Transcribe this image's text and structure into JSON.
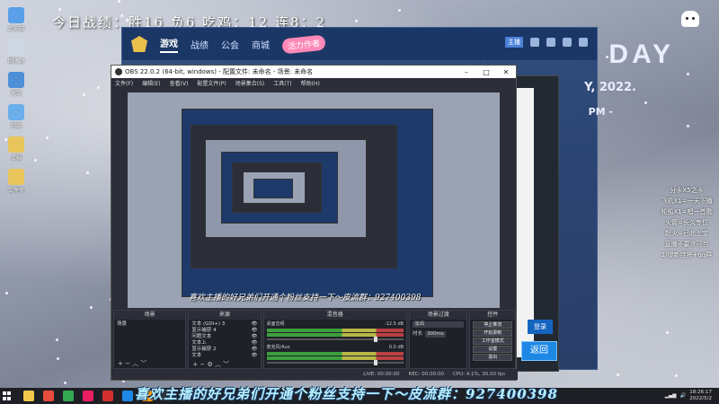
{
  "overlay": {
    "stats_line": "今日战绩：胜16  负6    吃鸡：12   连8：2"
  },
  "desktop": {
    "icons": [
      {
        "label": "此电脑",
        "color": "#5aa0e8"
      },
      {
        "label": "回收站",
        "color": "#cfd8e6"
      },
      {
        "label": "宽带",
        "color": "#4d90d8"
      },
      {
        "label": "网络",
        "color": "#6aaeea"
      },
      {
        "label": "文档",
        "color": "#e8c45a"
      },
      {
        "label": "文件夹",
        "color": "#e8c45a"
      }
    ]
  },
  "launcher": {
    "nav": [
      "游戏",
      "战绩",
      "公会",
      "商城"
    ],
    "badge": "活力作者",
    "user_tag": "主播",
    "day_text": "DAY",
    "year_text": "Y, 2022.",
    "pm_text": "PM -",
    "return_label": "返回",
    "blue_button": "登录"
  },
  "side_note": "分卡X5之卡\n飞机X1=一天下播\n轮船X1=唱一首歌\n火箭=长久专位\n超火=已此上宝\n直播不要许可当\n1/提新挂将+qq群",
  "obs": {
    "title": "OBS 22.0.2 (64-bit, windows) - 配置文件: 未命名 - 场景: 未命名",
    "menu": [
      "文件(F)",
      "编辑(E)",
      "查看(V)",
      "配置文件(P)",
      "场景集合(S)",
      "工具(T)",
      "帮助(H)"
    ],
    "docks": {
      "scenes": {
        "title": "场景",
        "items": [
          "场景"
        ]
      },
      "sources": {
        "title": "来源",
        "items": [
          "文本 (GDI+) 3",
          "显示捕获 4",
          "问题文本",
          "文本上",
          "显示捕获 2",
          "文本"
        ]
      },
      "mixer": {
        "title": "混音器",
        "channels": [
          {
            "name": "桌面音频",
            "db": "-12.5 dB"
          },
          {
            "name": "麦克风/Aux",
            "db": "0.0 dB"
          }
        ]
      },
      "transitions": {
        "title": "场景过渡",
        "type": "淡出",
        "duration_label": "时长",
        "duration": "300ms"
      },
      "controls": {
        "title": "控件",
        "buttons": [
          "停止推流",
          "开始录制",
          "工作室模式",
          "设置",
          "退出"
        ]
      }
    },
    "status": {
      "live": "LIVE: 00:00:00",
      "rec": "REC: 00:00:00",
      "cpu": "CPU: 4.1%, 30.00 fps"
    }
  },
  "preview_caption": "喜欢主播的好兄弟们开通个粉丝支持一下～皮流群：927400398",
  "bottom_caption": "喜欢主播的好兄弟们开通个粉丝支持一下～皮流群：927400398",
  "taskbar": {
    "apps": [
      {
        "name": "file-explorer-icon",
        "color": "#f2c94c"
      },
      {
        "name": "app-red-icon",
        "color": "#e74c3c"
      },
      {
        "name": "chrome-icon",
        "color": "#34a853"
      },
      {
        "name": "app-pink-icon",
        "color": "#e91e63"
      },
      {
        "name": "app-red2-icon",
        "color": "#d32f2f"
      },
      {
        "name": "app-blue-icon",
        "color": "#1e88e5"
      },
      {
        "name": "app-orange-icon",
        "color": "#ff9800"
      },
      {
        "name": "obs-icon",
        "color": "#333333"
      }
    ],
    "time": "18:26:17",
    "date": "2022/5/2"
  }
}
